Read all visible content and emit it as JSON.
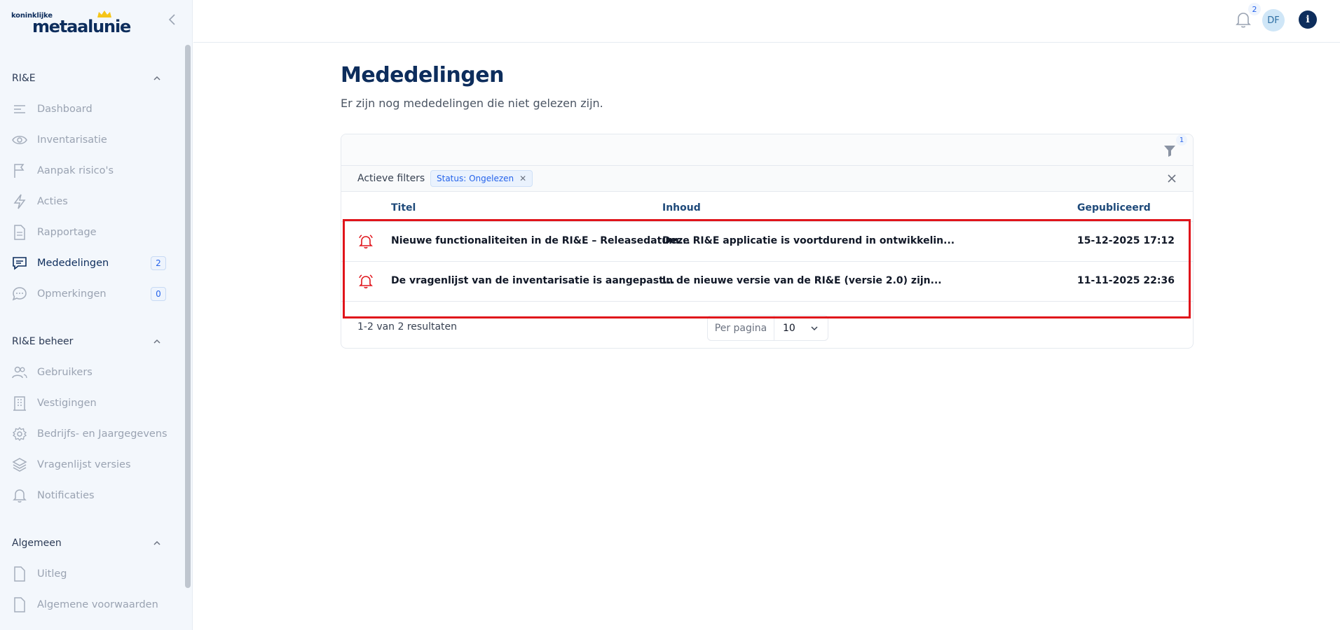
{
  "brand": {
    "small": "koninklijke",
    "big": "metaalunie"
  },
  "sidebar": {
    "sections": [
      {
        "title": "RI&E"
      },
      {
        "title": "RI&E beheer"
      },
      {
        "title": "Algemeen"
      }
    ],
    "items": [
      {
        "label": "Dashboard",
        "icon": "list-icon"
      },
      {
        "label": "Inventarisatie",
        "icon": "eye-icon"
      },
      {
        "label": "Aanpak risico's",
        "icon": "flag-icon"
      },
      {
        "label": "Acties",
        "icon": "lightning-icon"
      },
      {
        "label": "Rapportage",
        "icon": "document-icon"
      },
      {
        "label": "Mededelingen",
        "icon": "message-icon",
        "badge": "2"
      },
      {
        "label": "Opmerkingen",
        "icon": "comment-icon",
        "badge": "0"
      },
      {
        "label": "Gebruikers",
        "icon": "users-icon"
      },
      {
        "label": "Vestigingen",
        "icon": "building-icon"
      },
      {
        "label": "Bedrijfs- en Jaargegevens",
        "icon": "gear-icon"
      },
      {
        "label": "Vragenlijst versies",
        "icon": "layers-icon"
      },
      {
        "label": "Notificaties",
        "icon": "bell-icon"
      },
      {
        "label": "Uitleg",
        "icon": "file-icon"
      },
      {
        "label": "Algemene voorwaarden",
        "icon": "file-icon"
      }
    ]
  },
  "topbar": {
    "notification_count": "2",
    "avatar_initials": "DF",
    "info_label": "i"
  },
  "main": {
    "title": "Mededelingen",
    "subtitle": "Er zijn nog mededelingen die niet gelezen zijn.",
    "filter_count": "1",
    "active_filters_label": "Actieve filters",
    "filter_chip": "Status: Ongelezen",
    "columns": {
      "title": "Titel",
      "content": "Inhoud",
      "published": "Gepubliceerd"
    },
    "rows": [
      {
        "title": "Nieuwe functionaliteiten in de RI&E – Releasedatum...",
        "content": "Deze RI&E applicatie is voortdurend in ontwikkelin...",
        "published": "15-12-2025 17:12"
      },
      {
        "title": "De vragenlijst van de inventarisatie is aangepast...",
        "content": "In de nieuwe versie van de RI&E (versie 2.0) zijn...",
        "published": "11-11-2025 22:36"
      }
    ],
    "results_text": "1-2 van 2 resultaten",
    "per_page_label": "Per pagina",
    "per_page_value": "10"
  },
  "colors": {
    "navy": "#0d2d5c",
    "accent_red": "#e0141b",
    "link_blue": "#2563eb"
  }
}
